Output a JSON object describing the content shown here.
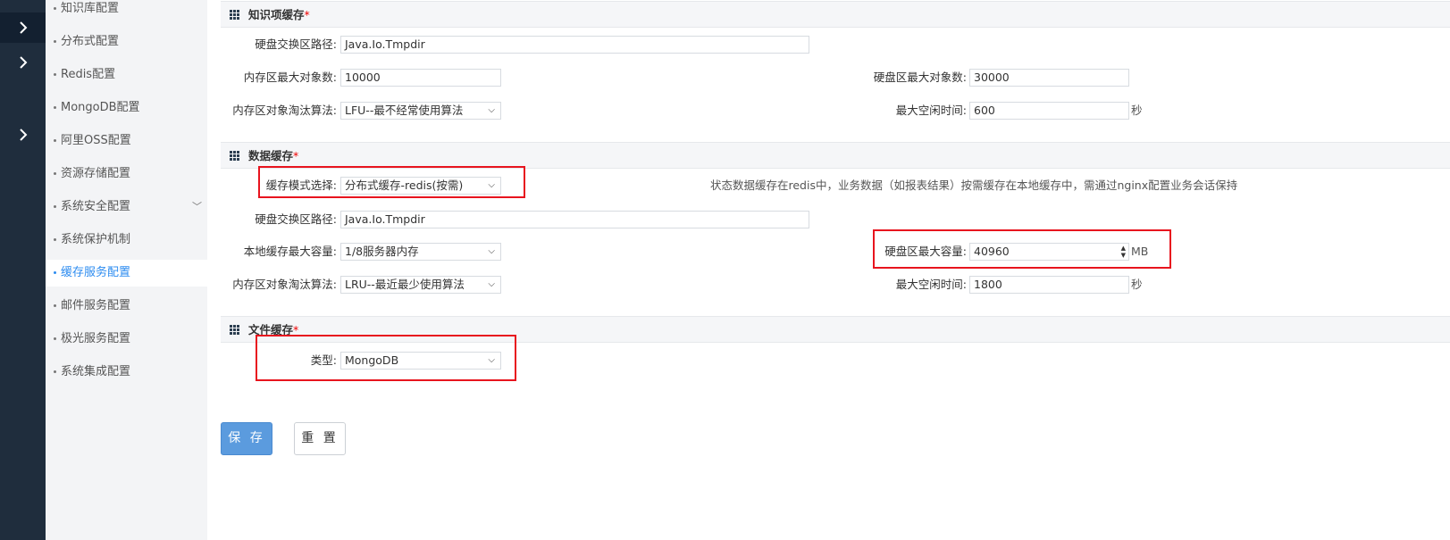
{
  "rail": {
    "icons": [
      "chevron-right-icon",
      "chevron-right-icon",
      "chevron-right-icon"
    ]
  },
  "menu": {
    "items": [
      {
        "label": "知识库配置"
      },
      {
        "label": "分布式配置"
      },
      {
        "label": "Redis配置"
      },
      {
        "label": "MongoDB配置"
      },
      {
        "label": "阿里OSS配置"
      },
      {
        "label": "资源存储配置"
      },
      {
        "label": "系统安全配置"
      },
      {
        "label": "系统保护机制"
      },
      {
        "label": "缓存服务配置"
      },
      {
        "label": "邮件服务配置"
      },
      {
        "label": "极光服务配置"
      },
      {
        "label": "系统集成配置"
      }
    ],
    "active": "缓存服务配置",
    "caret": "﹀"
  },
  "required_mark": "*",
  "knowledge_cache": {
    "title": "知识项缓存",
    "disk_swap_path_label": "硬盘交换区路径:",
    "disk_swap_path": "Java.Io.Tmpdir",
    "mem_max_objects_label": "内存区最大对象数:",
    "mem_max_objects": "10000",
    "disk_max_objects_label": "硬盘区最大对象数:",
    "disk_max_objects": "30000",
    "eviction_label": "内存区对象淘汰算法:",
    "eviction": "LFU--最不经常使用算法",
    "idle_label": "最大空闲时间:",
    "idle": "600",
    "idle_unit": "秒"
  },
  "data_cache": {
    "title": "数据缓存",
    "mode_label": "缓存模式选择:",
    "mode": "分布式缓存-redis(按需)",
    "mode_note": "状态数据缓存在redis中，业务数据（如报表结果）按需缓存在本地缓存中，需通过nginx配置业务会话保持",
    "disk_swap_path_label": "硬盘交换区路径:",
    "disk_swap_path": "Java.Io.Tmpdir",
    "local_max_label": "本地缓存最大容量:",
    "local_max": "1/8服务器内存",
    "disk_max_label": "硬盘区最大容量:",
    "disk_max": "40960",
    "disk_max_unit": "MB",
    "eviction_label": "内存区对象淘汰算法:",
    "eviction": "LRU--最近最少使用算法",
    "idle_label": "最大空闲时间:",
    "idle": "1800",
    "idle_unit": "秒"
  },
  "file_cache": {
    "title": "文件缓存",
    "type_label": "类型:",
    "type": "MongoDB"
  },
  "buttons": {
    "save": "保 存",
    "reset": "重 置"
  },
  "highlight_color": "#e8141e",
  "accent_color": "#2d8cf0"
}
